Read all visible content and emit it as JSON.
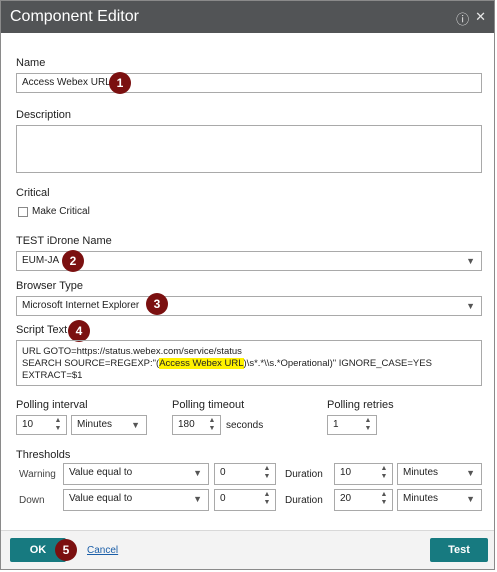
{
  "window": {
    "title": "Component Editor",
    "help_icon": "question-circle-icon",
    "close_icon": "close-icon"
  },
  "name": {
    "label": "Name",
    "value": "Access Webex URL",
    "badge": "1"
  },
  "description": {
    "label": "Description",
    "value": ""
  },
  "critical": {
    "label": "Critical",
    "checkbox_label": "Make Critical",
    "checked": false
  },
  "idrone": {
    "label": "TEST iDrone Name",
    "value": "EUM-JA",
    "badge": "2"
  },
  "browser": {
    "label": "Browser Type",
    "value": "Microsoft Internet Explorer",
    "badge": "3"
  },
  "script": {
    "label": "Script Text",
    "badge": "4",
    "line1": "URL GOTO=https://status.webex.com/service/status",
    "line2_prefix": "SEARCH SOURCE=REGEXP:\"(",
    "line2_highlight": "Access Webex URL",
    "line2_suffix": ")\\s*.*\\\\s.*Operational)\" IGNORE_CASE=YES EXTRACT=$1"
  },
  "polling": {
    "interval_label": "Polling interval",
    "interval_value": "10",
    "interval_unit": "Minutes",
    "timeout_label": "Polling timeout",
    "timeout_value": "180",
    "timeout_unit": "seconds",
    "retries_label": "Polling retries",
    "retries_value": "1"
  },
  "thresholds": {
    "label": "Thresholds",
    "rows": [
      {
        "name": "Warning",
        "condition": "Value equal to",
        "value": "0",
        "duration_label": "Duration",
        "duration": "10",
        "unit": "Minutes"
      },
      {
        "name": "Down",
        "condition": "Value equal to",
        "value": "0",
        "duration_label": "Duration",
        "duration": "20",
        "unit": "Minutes"
      }
    ]
  },
  "footer": {
    "ok_label": "OK",
    "ok_badge": "5",
    "cancel_label": "Cancel",
    "test_label": "Test"
  },
  "colors": {
    "titlebar": "#525456",
    "primary_button": "#177a80",
    "badge": "#7b1010",
    "highlight": "#fff200"
  }
}
